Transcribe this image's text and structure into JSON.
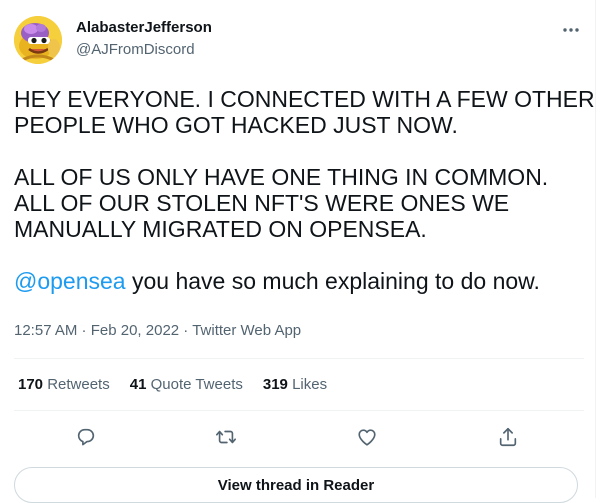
{
  "author": {
    "display_name": "AlabasterJefferson",
    "handle": "@AJFromDiscord"
  },
  "tweet": {
    "line1": "HEY EVERYONE. I CONNECTED WITH A FEW OTHER",
    "line2": "PEOPLE WHO GOT HACKED JUST NOW.",
    "line3": "ALL OF US ONLY HAVE ONE THING IN COMMON.",
    "line4": "ALL OF OUR STOLEN NFT'S WERE ONES WE",
    "line5": "MANUALLY MIGRATED ON OPENSEA.",
    "mention": "@opensea",
    "line6_rest": " you have so much explaining to do now."
  },
  "meta": {
    "time": "12:57 AM",
    "sep1": " · ",
    "date": "Feb 20, 2022",
    "sep2": " · ",
    "source": "Twitter Web App"
  },
  "stats": {
    "retweets_count": "170",
    "retweets_label": " Retweets",
    "quotes_count": "41",
    "quotes_label": " Quote Tweets",
    "likes_count": "319",
    "likes_label": " Likes"
  },
  "reader_button": "View thread in Reader",
  "icons": {
    "more": "more-horizontal-icon",
    "reply": "reply-icon",
    "retweet": "retweet-icon",
    "like": "heart-icon",
    "share": "share-icon"
  },
  "colors": {
    "text": "#0f1419",
    "secondary": "#536471",
    "accent": "#1d9bf0",
    "border": "#cfd9de"
  }
}
